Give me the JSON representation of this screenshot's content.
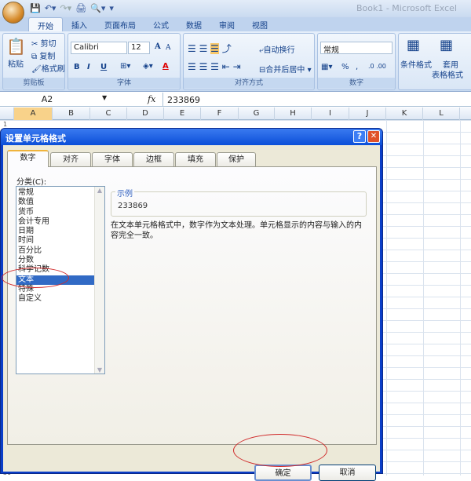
{
  "window": {
    "title": "Book1 - Microsoft Excel"
  },
  "ribbon": {
    "tabs": [
      "开始",
      "插入",
      "页面布局",
      "公式",
      "数据",
      "审阅",
      "视图"
    ],
    "clipboard": {
      "paste": "粘贴",
      "cut": "剪切",
      "copy": "复制",
      "format_painter": "格式刷",
      "label": "剪贴板"
    },
    "font": {
      "name": "Calibri",
      "size": "12",
      "bold": "B",
      "italic": "I",
      "underline": "U",
      "grow": "A",
      "shrink": "A",
      "font_color": "A",
      "label": "字体"
    },
    "alignment": {
      "wrap": "自动换行",
      "merge": "合并后居中",
      "label": "对齐方式"
    },
    "number": {
      "format": "常规",
      "percent": "%",
      "comma": ",",
      "label": "数字"
    },
    "styles": {
      "conditional": "条件格式",
      "table": "套用",
      "table2": "表格格式"
    }
  },
  "formula_bar": {
    "name_box": "A2",
    "fx": "fx",
    "value": "233869"
  },
  "columns": [
    "A",
    "B",
    "C",
    "D",
    "E",
    "F",
    "G",
    "H",
    "I",
    "J",
    "K",
    "L"
  ],
  "row_numbers": [
    "1",
    "30"
  ],
  "dialog": {
    "title": "设置单元格格式",
    "tabs": [
      "数字",
      "对齐",
      "字体",
      "边框",
      "填充",
      "保护"
    ],
    "category_label": "分类(C):",
    "categories": [
      "常规",
      "数值",
      "货币",
      "会计专用",
      "日期",
      "时间",
      "百分比",
      "分数",
      "科学记数",
      "文本",
      "特殊",
      "自定义"
    ],
    "selected": "文本",
    "sample_label": "示例",
    "sample_value": "233869",
    "description": "在文本单元格格式中，数字作为文本处理。单元格显示的内容与输入的内容完全一致。",
    "ok": "确定",
    "cancel": "取消",
    "help": "?",
    "close": "✕"
  }
}
